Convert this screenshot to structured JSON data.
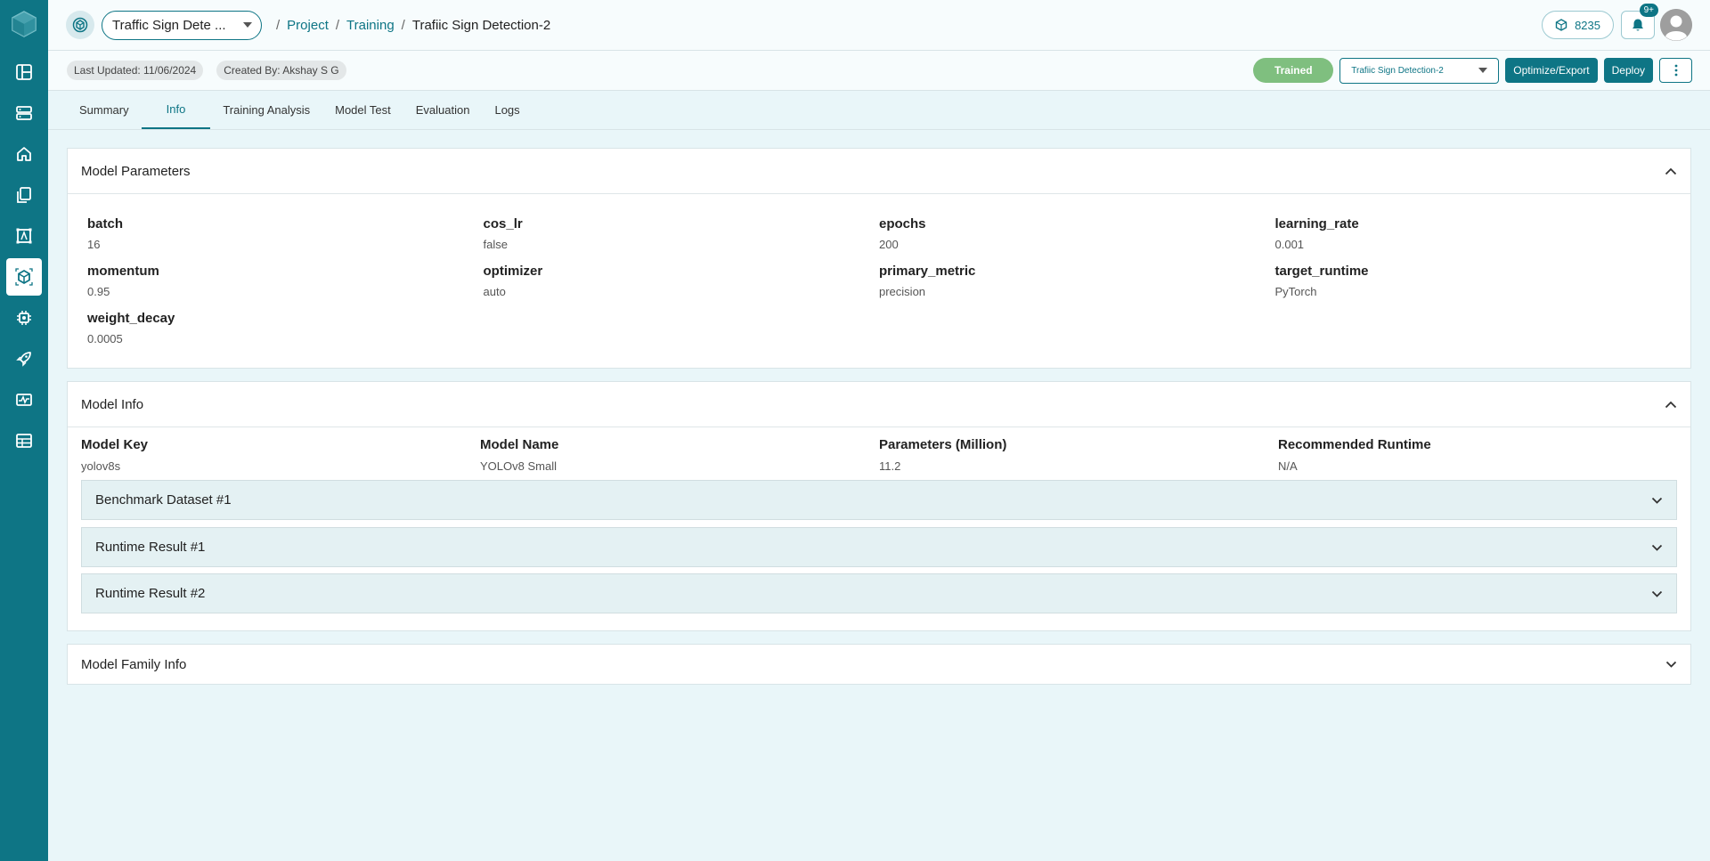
{
  "header": {
    "project_select": "Traffic Sign Dete ...",
    "breadcrumb": {
      "project": "Project",
      "training": "Training",
      "current": "Trafiic Sign Detection-2",
      "separator": "/"
    },
    "credits": "8235",
    "notification_badge": "9+"
  },
  "meta": {
    "last_updated": "Last Updated: 11/06/2024",
    "created_by": "Created By: Akshay S G",
    "status": "Trained",
    "model_select": "Trafiic Sign Detection-2",
    "optimize_label": "Optimize/Export",
    "deploy_label": "Deploy"
  },
  "tabs": [
    "Summary",
    "Info",
    "Training Analysis",
    "Model Test",
    "Evaluation",
    "Logs"
  ],
  "model_parameters": {
    "title": "Model Parameters",
    "items": [
      {
        "key": "batch",
        "value": "16"
      },
      {
        "key": "cos_lr",
        "value": "false"
      },
      {
        "key": "epochs",
        "value": "200"
      },
      {
        "key": "learning_rate",
        "value": "0.001"
      },
      {
        "key": "momentum",
        "value": "0.95"
      },
      {
        "key": "optimizer",
        "value": "auto"
      },
      {
        "key": "primary_metric",
        "value": "precision"
      },
      {
        "key": "target_runtime",
        "value": "PyTorch"
      },
      {
        "key": "weight_decay",
        "value": "0.0005"
      }
    ]
  },
  "model_info": {
    "title": "Model Info",
    "items": [
      {
        "key": "Model Key",
        "value": "yolov8s"
      },
      {
        "key": "Model Name",
        "value": "YOLOv8 Small"
      },
      {
        "key": "Parameters (Million)",
        "value": "11.2"
      },
      {
        "key": "Recommended Runtime",
        "value": "N/A"
      }
    ],
    "sections": [
      "Benchmark Dataset #1",
      "Runtime Result #1",
      "Runtime Result #2"
    ]
  },
  "model_family": {
    "title": "Model Family Info"
  },
  "colors": {
    "primary": "#0e7585",
    "trained": "#7fbf7f",
    "background": "#e9f6f9"
  }
}
